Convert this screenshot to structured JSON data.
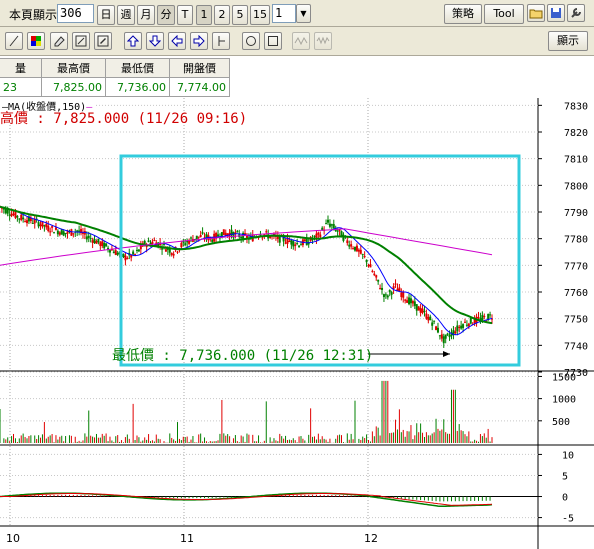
{
  "toolbar": {
    "page_display_label": "本頁顯示",
    "page_count": "306",
    "period_day": "日",
    "period_week": "週",
    "period_month": "月",
    "period_minute": "分",
    "period_tick": "T",
    "min_1": "1",
    "min_2": "2",
    "min_5": "5",
    "min_15": "15",
    "interval_value": "1",
    "strategy": "策略",
    "tool": "Tool",
    "show": "顯示"
  },
  "quote": {
    "headers": [
      "量",
      "最高價",
      "最低價",
      "開盤價"
    ],
    "values": [
      "23",
      "7,825.00",
      "7,736.00",
      "7,774.00"
    ]
  },
  "annotations": {
    "ma_label": "MA(收盤價,150)",
    "high": "高價 : 7,825.000 (11/26 09:16)",
    "low": "最低價 : 7,736.000 (11/26 12:31)"
  },
  "chart_data": {
    "type": "line",
    "price_axis": {
      "ticks": [
        7730,
        7740,
        7750,
        7760,
        7770,
        7780,
        7790,
        7800,
        7810,
        7820,
        7830
      ],
      "ylim": [
        7730,
        7832
      ]
    },
    "volume_axis": {
      "ticks": [
        500,
        1000,
        1500
      ]
    },
    "osc_axis": {
      "ticks": [
        -5,
        0,
        5,
        10
      ]
    },
    "x_tick_labels": [
      "10",
      "11",
      "12"
    ],
    "colors": {
      "candle_up": "#e00000",
      "candle_down": "#008000",
      "ma_short": "#0000ff",
      "ma_mid": "#008000",
      "ma_long": "#cc00cc",
      "highlight": "#33ccdd"
    },
    "price_close": [
      7792,
      7790,
      7788,
      7787,
      7786,
      7784,
      7783,
      7782,
      7783,
      7781,
      7779,
      7777,
      7775,
      7773,
      7774,
      7778,
      7779,
      7777,
      7775,
      7778,
      7780,
      7781,
      7780,
      7782,
      7782,
      7781,
      7780,
      7782,
      7781,
      7780,
      7779,
      7778,
      7779,
      7781,
      7786,
      7783,
      7779,
      7776,
      7772,
      7765,
      7758,
      7762,
      7758,
      7755,
      7752,
      7748,
      7742,
      7745,
      7748,
      7749,
      7750,
      7751
    ]
  }
}
